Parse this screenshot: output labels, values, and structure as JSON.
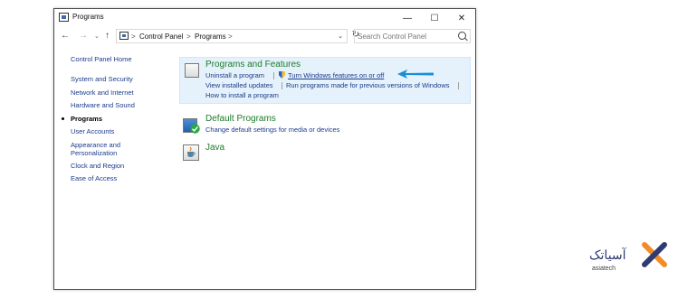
{
  "window": {
    "title": "Programs",
    "controls": {
      "minimize": "—",
      "maximize": "☐",
      "close": "✕"
    }
  },
  "navigation": {
    "back": "←",
    "forward": "→",
    "recent": "⌄",
    "up": "↑"
  },
  "address": {
    "crumbs": [
      "Control Panel",
      "Programs"
    ],
    "separator": ">",
    "dropdown": "⌄",
    "refresh": "↻"
  },
  "search": {
    "placeholder": "Search Control Panel"
  },
  "sidebar": {
    "home": "Control Panel Home",
    "items": [
      {
        "label": "System and Security"
      },
      {
        "label": "Network and Internet"
      },
      {
        "label": "Hardware and Sound"
      },
      {
        "label": "Programs",
        "active": true
      },
      {
        "label": "User Accounts"
      },
      {
        "label": "Appearance and\nPersonalization"
      },
      {
        "label": "Clock and Region"
      },
      {
        "label": "Ease of Access"
      }
    ]
  },
  "categories": {
    "programs_features": {
      "title": "Programs and Features",
      "links": {
        "uninstall": "Uninstall a program",
        "turn_features": "Turn Windows features on or off",
        "view_updates": "View installed updates",
        "run_previous": "Run programs made for previous versions of Windows",
        "how_install": "How to install a program"
      }
    },
    "default_programs": {
      "title": "Default Programs",
      "links": {
        "change_defaults": "Change default settings for media or devices"
      }
    },
    "java": {
      "title": "Java"
    }
  },
  "watermark": {
    "text_fa": "آسیاتک",
    "text_en": "asiatech"
  },
  "colors": {
    "link": "#1a3c8c",
    "category_title": "#1e7b2a",
    "highlight": "#e5f1fb",
    "arrow": "#1a8fd8",
    "logo_orange": "#f28c28",
    "logo_blue": "#2f3c73"
  }
}
